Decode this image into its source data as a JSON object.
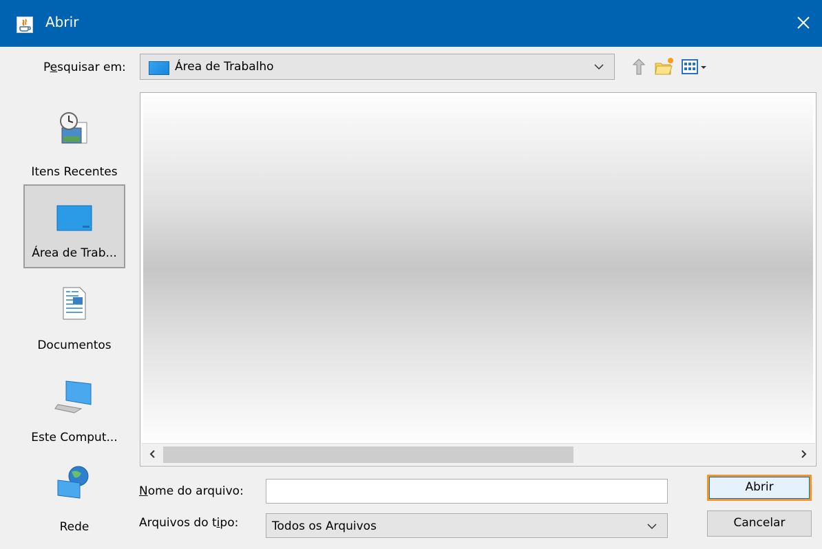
{
  "window": {
    "title": "Abrir"
  },
  "look_in": {
    "label": "Pesquisar em:",
    "mnemonic_index": 1,
    "value": "Área de Trabalho"
  },
  "toolbar": {
    "up_icon": "up-folder-icon",
    "new_folder_icon": "new-folder-icon",
    "view_menu_icon": "view-menu-icon"
  },
  "places": [
    {
      "label": "Itens Recentes",
      "icon": "recent-items-icon",
      "selected": false
    },
    {
      "label": "Área de Trab...",
      "icon": "desktop-icon",
      "selected": true
    },
    {
      "label": "Documentos",
      "icon": "documents-icon",
      "selected": false
    },
    {
      "label": "Este Comput...",
      "icon": "computer-icon",
      "selected": false
    },
    {
      "label": "Rede",
      "icon": "network-icon",
      "selected": false
    }
  ],
  "file_name": {
    "label": "Nome do arquivo:",
    "value": "",
    "placeholder": ""
  },
  "file_type": {
    "label": "Arquivos do tipo:",
    "value": "Todos os Arquivos"
  },
  "buttons": {
    "open": "Abrir",
    "cancel": "Cancelar"
  },
  "colors": {
    "titlebar": "#0063b1",
    "focus_border": "#f7931e"
  }
}
